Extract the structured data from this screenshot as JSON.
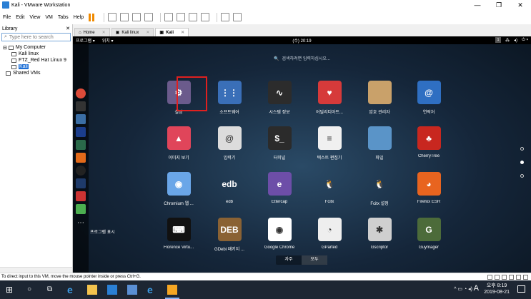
{
  "window": {
    "title": "Kali - VMware Workstation"
  },
  "menu": [
    "File",
    "Edit",
    "View",
    "VM",
    "Tabs",
    "Help"
  ],
  "library": {
    "title": "Library",
    "search_placeholder": "Type here to search",
    "tree": [
      {
        "label": "My Computer",
        "level": 0
      },
      {
        "label": "Kali linux",
        "level": 1
      },
      {
        "label": "FTZ_Red Hat Linux 9",
        "level": 1
      },
      {
        "label": "Kali",
        "level": 1,
        "selected": true
      },
      {
        "label": "Shared VMs",
        "level": 0
      }
    ]
  },
  "tabs": [
    {
      "label": "Home",
      "active": false
    },
    {
      "label": "Kali linux",
      "active": false
    },
    {
      "label": "Kali",
      "active": true
    }
  ],
  "vm": {
    "topbar": {
      "programs": "프로그램 ▾",
      "places": "위치 ▾",
      "clock": "(수) 20:19",
      "workspace": "1"
    },
    "search_text": "검색하려면 입력하십시오...",
    "show_apps_label": "프로그램 표시",
    "apps": [
      {
        "label": "설정",
        "color": "#6b5b8c",
        "glyph": "⚙"
      },
      {
        "label": "소프트웨어",
        "color": "#3a6fb8",
        "glyph": "⋮⋮"
      },
      {
        "label": "시스템 정보",
        "color": "#2c2c2c",
        "glyph": "∿"
      },
      {
        "label": "어딜리티아트...",
        "color": "#d63a3a",
        "glyph": "♥"
      },
      {
        "label": "암호 관리자",
        "color": "#c9a16a",
        "glyph": ""
      },
      {
        "label": "연락처",
        "color": "#2f6fc2",
        "glyph": "@"
      },
      {
        "label": "이미지 보기",
        "color": "#e0455a",
        "glyph": "▲"
      },
      {
        "label": "입력기",
        "color": "#dcdcdc",
        "glyph": "@"
      },
      {
        "label": "터미널",
        "color": "#2b2b2b",
        "glyph": "$_"
      },
      {
        "label": "텍스트 편집기",
        "color": "#f0f0f0",
        "glyph": "≡"
      },
      {
        "label": "파일",
        "color": "#5a94c8",
        "glyph": ""
      },
      {
        "label": "CherryTree",
        "color": "#c8271f",
        "glyph": "♣"
      },
      {
        "label": "Chromium 웹 ...",
        "color": "#6aa6e8",
        "glyph": "◉"
      },
      {
        "label": "edb",
        "color": "transparent",
        "glyph": "edb"
      },
      {
        "label": "Ettercap",
        "color": "#6d4ea8",
        "glyph": "e"
      },
      {
        "label": "Fcitx",
        "color": "transparent",
        "glyph": "🐧"
      },
      {
        "label": "Fcitx 설정",
        "color": "transparent",
        "glyph": "🐧"
      },
      {
        "label": "Firefox ESR",
        "color": "#e8641f",
        "glyph": "◕"
      },
      {
        "label": "Florence Virtu...",
        "color": "#111111",
        "glyph": "⌨"
      },
      {
        "label": "GDebi 패키지 ...",
        "color": "#8a6234",
        "glyph": "DEB"
      },
      {
        "label": "Google Chrome",
        "color": "#ffffff",
        "glyph": "◉"
      },
      {
        "label": "GParted",
        "color": "#eeeeee",
        "glyph": "◔"
      },
      {
        "label": "Gscriptor",
        "color": "#cfcfcf",
        "glyph": "✱"
      },
      {
        "label": "Guymager",
        "color": "#4c6b3a",
        "glyph": "G"
      }
    ],
    "switch": {
      "frequent": "자주",
      "all": "모두"
    }
  },
  "status": {
    "hint": "To direct input to this VM, move the mouse pointer inside or press Ctrl+G."
  },
  "taskbar": {
    "time": "오후 8:19",
    "date": "2019-08-21",
    "lang": "A",
    "tray": "ᴬ⁸"
  }
}
